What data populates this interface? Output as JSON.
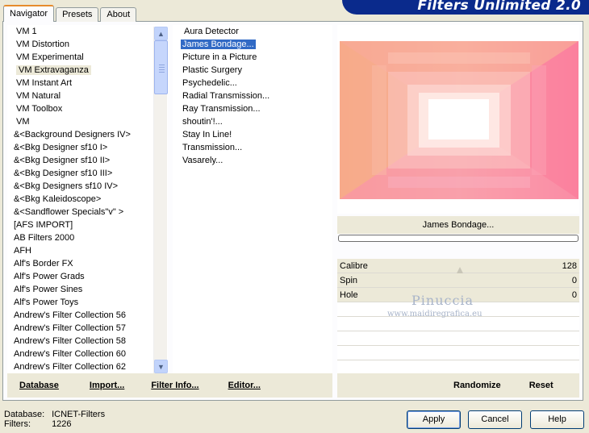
{
  "tabs": [
    {
      "label": "Navigator",
      "active": true
    },
    {
      "label": "Presets",
      "active": false
    },
    {
      "label": "About",
      "active": false
    }
  ],
  "header": {
    "title": "Filters Unlimited 2.0"
  },
  "categories": {
    "selected_index": 3,
    "items": [
      "VM 1",
      "VM Distortion",
      "VM Experimental",
      "VM Extravaganza",
      "VM Instant Art",
      "VM Natural",
      "VM Toolbox",
      "VM",
      "&<Background Designers IV>",
      "&<Bkg Designer sf10 I>",
      "&<Bkg Designer sf10 II>",
      "&<Bkg Designer sf10 III>",
      "&<Bkg Designers sf10 IV>",
      "&<Bkg Kaleidoscope>",
      "&<Sandflower Specials\"v\" >",
      "[AFS IMPORT]",
      "AB Filters 2000",
      "AFH",
      "Alf's Border FX",
      "Alf's Power Grads",
      "Alf's Power Sines",
      "Alf's Power Toys",
      "Andrew's Filter Collection 56",
      "Andrew's Filter Collection 57",
      "Andrew's Filter Collection 58",
      "Andrew's Filter Collection 60",
      "Andrew's Filter Collection 62"
    ]
  },
  "filters": {
    "selected_index": 1,
    "items": [
      "Aura Detector",
      "James Bondage...",
      "Picture in a Picture",
      "Plastic Surgery",
      "Psychedelic...",
      "Radial Transmission...",
      "Ray Transmission...",
      "shoutin'!...",
      "Stay In Line!",
      "Transmission...",
      "Vasarely..."
    ]
  },
  "preview": {
    "filter_name": "James Bondage...",
    "colors": {
      "pink": "#f98aa0",
      "peach": "#f7b38c",
      "white": "#ffffff"
    }
  },
  "params": [
    {
      "name": "Calibre",
      "value": "128"
    },
    {
      "name": "Spin",
      "value": "0"
    },
    {
      "name": "Hole",
      "value": "0"
    }
  ],
  "watermark": {
    "line1": "Pinuccia",
    "line2": "www.maidiregrafica.eu"
  },
  "left_buttons": {
    "database": "Database",
    "import": "Import...",
    "filter_info": "Filter Info...",
    "editor": "Editor..."
  },
  "right_buttons": {
    "randomize": "Randomize",
    "reset": "Reset"
  },
  "status": {
    "database_label": "Database:",
    "database_value": "ICNET-Filters",
    "filters_label": "Filters:",
    "filters_value": "1226"
  },
  "dialog_buttons": {
    "apply": "Apply",
    "cancel": "Cancel",
    "help": "Help"
  }
}
